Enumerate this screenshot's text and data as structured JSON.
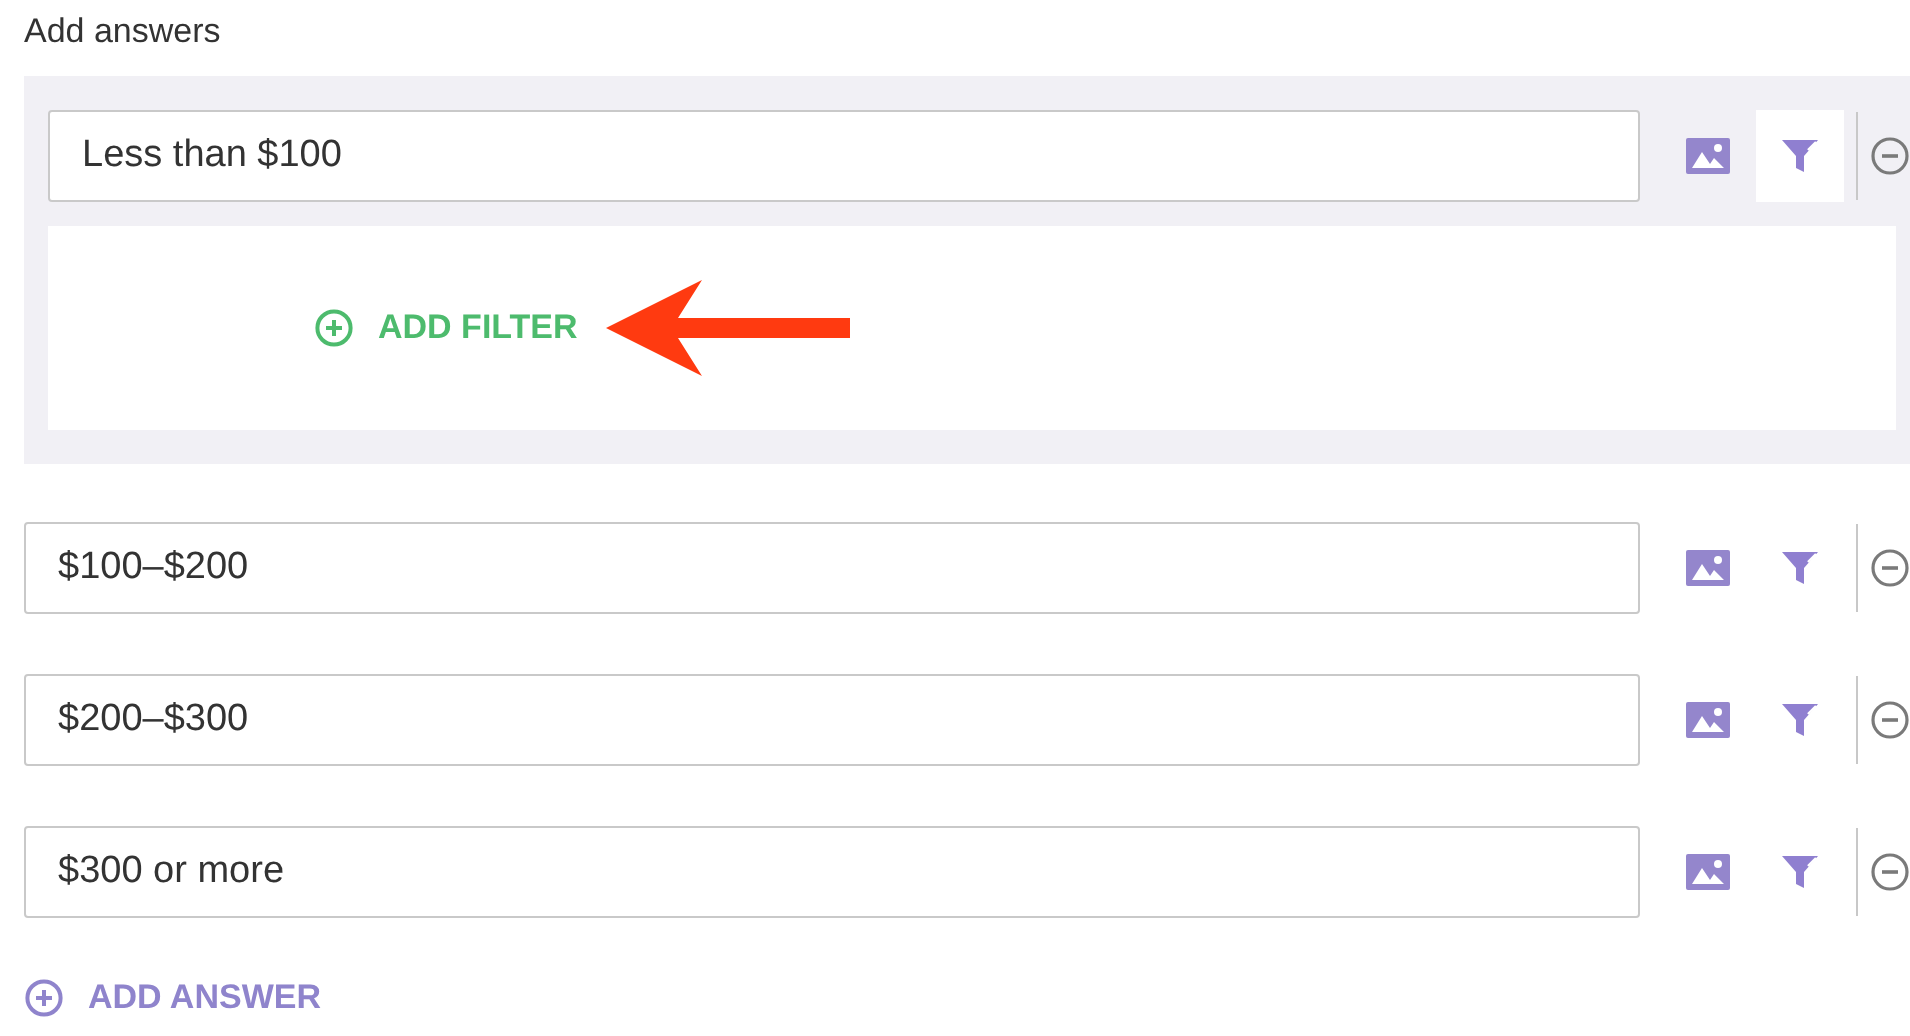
{
  "section_title": "Add answers",
  "answers": [
    {
      "text": "Less than $100",
      "expanded": true
    },
    {
      "text": "$100–$200",
      "expanded": false
    },
    {
      "text": "$200–$300",
      "expanded": false
    },
    {
      "text": "$300 or more",
      "expanded": false
    }
  ],
  "add_filter_label": "ADD FILTER",
  "add_answer_label": "ADD ANSWER"
}
